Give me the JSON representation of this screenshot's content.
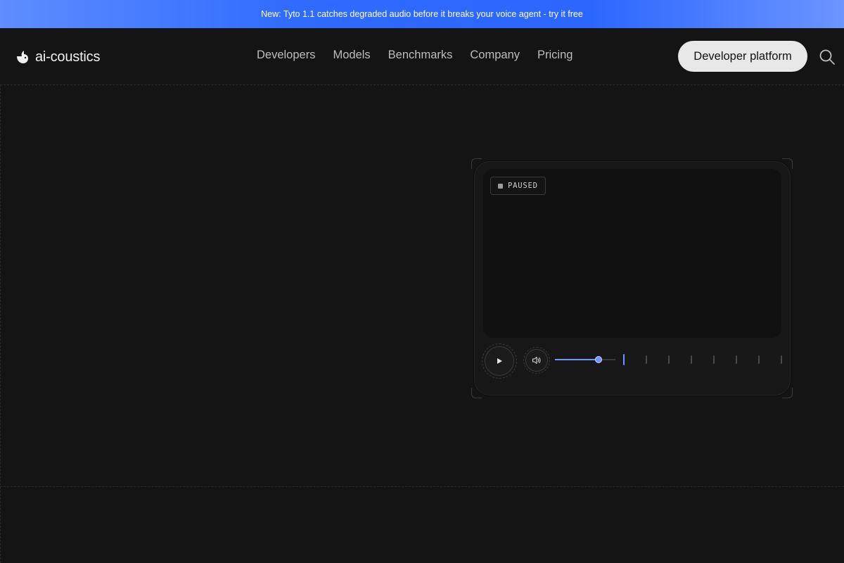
{
  "announcement": {
    "text": "New: Tyto 1.1 catches degraded audio before it breaks your voice agent - try it free"
  },
  "header": {
    "brand": "ai-coustics",
    "nav": [
      "Developers",
      "Models",
      "Benchmarks",
      "Company",
      "Pricing"
    ],
    "cta_label": "Developer platform",
    "search_icon": "search-icon"
  },
  "player": {
    "status": "PAUSED",
    "play_icon": "play-icon",
    "volume_icon": "speaker-icon",
    "volume_level": 0.75,
    "tick_count": 8,
    "active_tick": 0,
    "accent_color": "#6f95ff"
  }
}
